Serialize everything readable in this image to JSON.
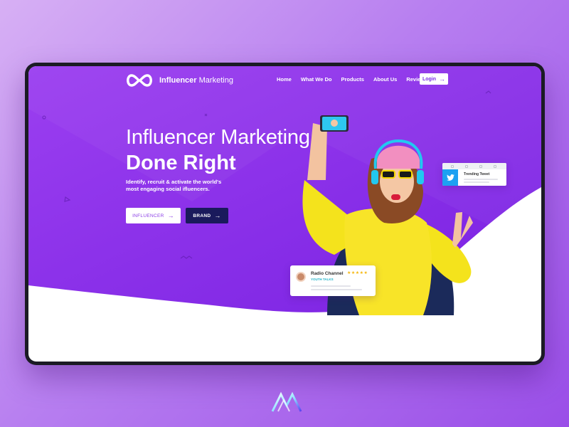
{
  "nav": {
    "brand_bold": "Influencer",
    "brand_light": "Marketing",
    "items": [
      "Home",
      "What We Do",
      "Products",
      "About Us",
      "Reviews"
    ],
    "login_label": "Login"
  },
  "hero": {
    "title_light": "Influencer Marketing",
    "title_bold": "Done Right",
    "subtitle_line1": "Identify, recruit & activate the world's",
    "subtitle_line2": "most engaging social ifluencers.",
    "primary_button": "INFLUENCER",
    "secondary_button": "BRAND"
  },
  "cards": {
    "radio": {
      "title": "Radio Channel",
      "subtitle": "YOUTH TALKS",
      "stars": "★★★★★"
    },
    "tweet": {
      "title": "Trending Tweet"
    }
  },
  "colors": {
    "hero_purple": "#8b2fe6",
    "accent_navy": "#1a1a5c",
    "twitter_blue": "#1da1f2",
    "star_gold": "#f5b70e"
  },
  "icons": [
    "infinity-logo-icon",
    "arrow-right-icon",
    "twitter-bird-icon",
    "brand-mark-icon"
  ]
}
